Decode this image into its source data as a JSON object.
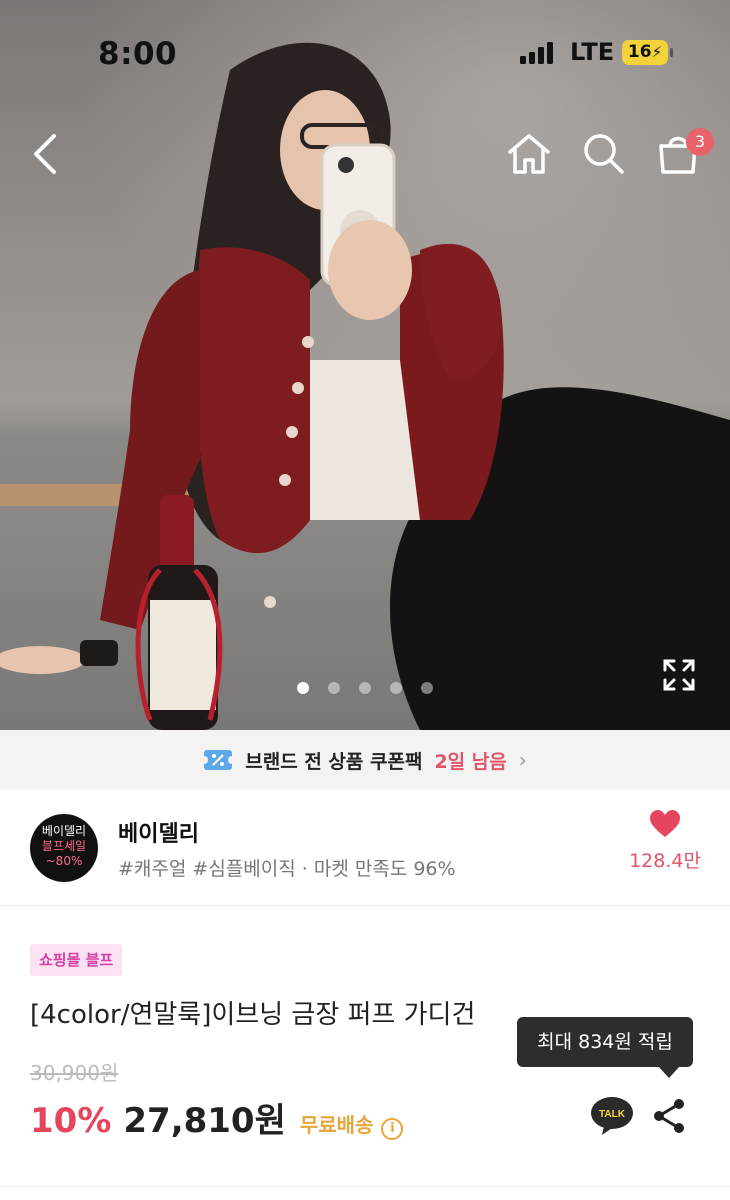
{
  "status_bar": {
    "time": "8:00",
    "network": "LTE",
    "battery": "16"
  },
  "header": {
    "cart_count": "3"
  },
  "gallery": {
    "total_images": 5,
    "active_index": 0
  },
  "coupon": {
    "text": "브랜드 전 상품 쿠폰팩",
    "days_left": "2일 남음"
  },
  "store": {
    "logo_lines": [
      "베이델리",
      "블프세일",
      "~80%"
    ],
    "name": "베이델리",
    "tags": "#캐주얼 #심플베이직 · 마켓 만족도 96%",
    "likes": "128.4만"
  },
  "product": {
    "badge": "쇼핑몰 블프",
    "name": "[4color/연말룩]이브닝 금장 퍼프 가디건",
    "original_price": "30,900원",
    "discount": "10%",
    "price": "27,810원",
    "shipping": "무료배송",
    "points_tooltip": "최대 834원 적립",
    "talk_label": "TALK"
  },
  "colors": {
    "accent_red": "#e4465d",
    "shipping": "#e8a63a",
    "badge_bg": "#fbe3f3",
    "badge_text": "#d63fa6"
  }
}
